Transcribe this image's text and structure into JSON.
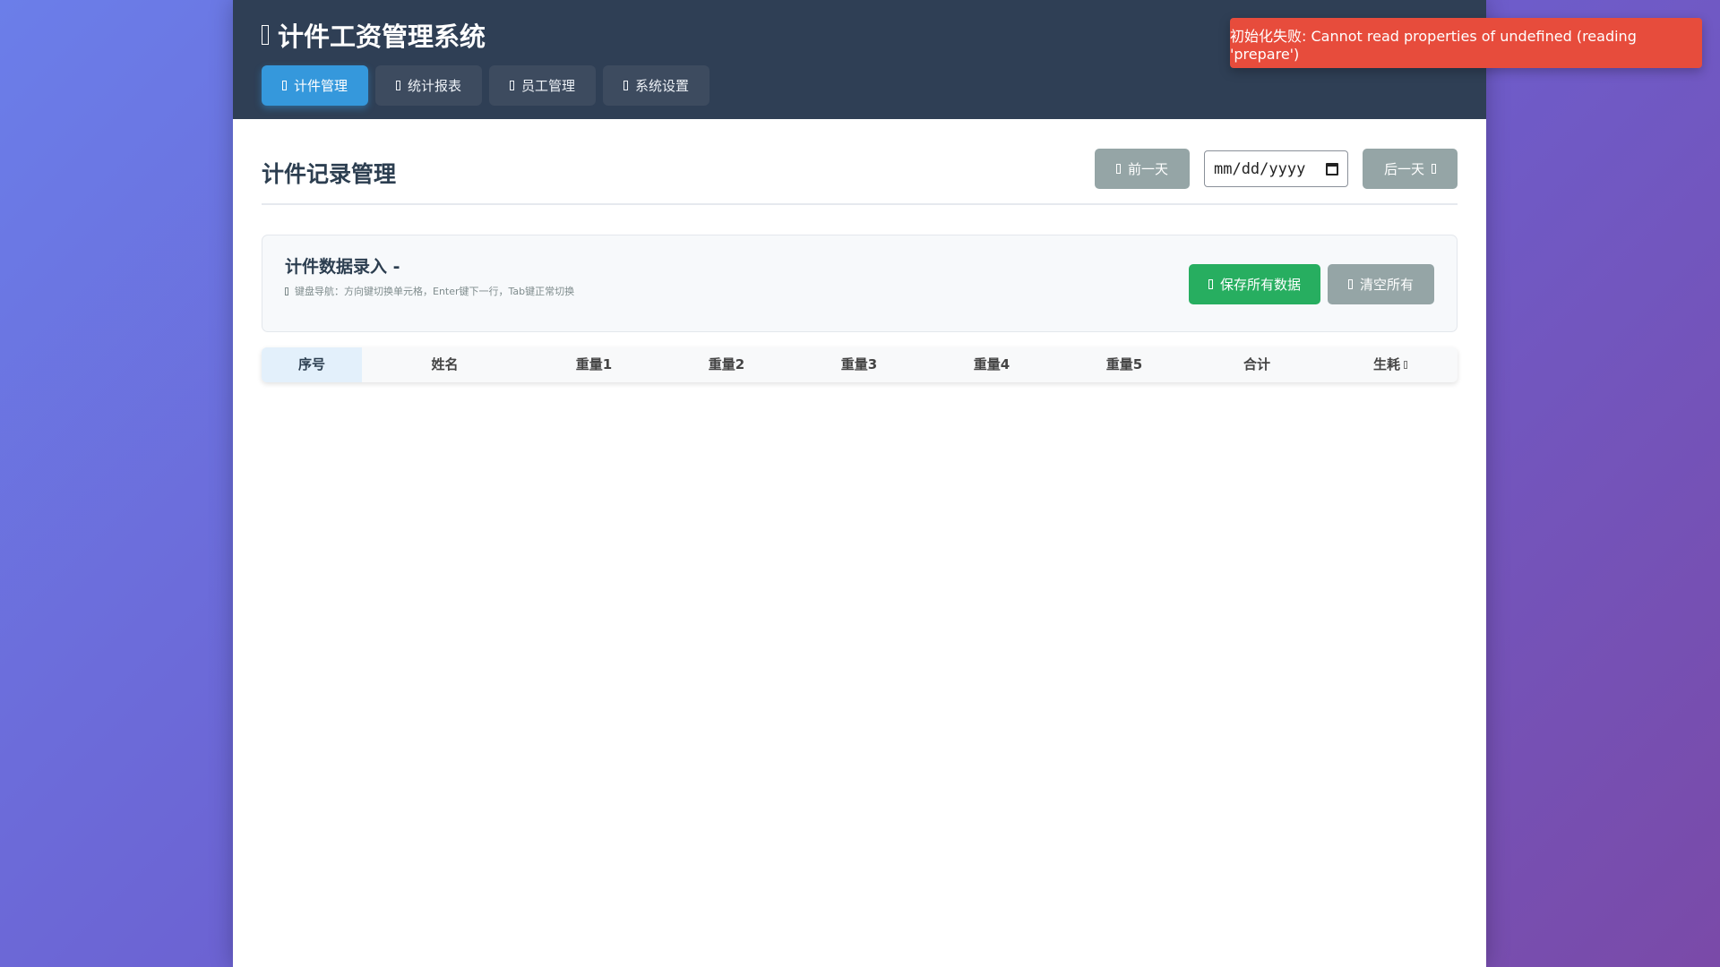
{
  "header": {
    "title": "计件工资管理系统",
    "title_icon": "app-logo-icon",
    "tabs": [
      {
        "label": "计件管理",
        "icon": "edit-icon",
        "active": true
      },
      {
        "label": "统计报表",
        "icon": "chart-icon",
        "active": false
      },
      {
        "label": "员工管理",
        "icon": "users-icon",
        "active": false
      },
      {
        "label": "系统设置",
        "icon": "settings-icon",
        "active": false
      }
    ]
  },
  "toast": {
    "message": "初始化失败: Cannot read properties of undefined (reading 'prepare')",
    "color": "#e74c3c"
  },
  "page": {
    "title": "计件记录管理",
    "prev_day": "前一天",
    "next_day": "后一天",
    "date_value": "",
    "date_placeholder": "mm/dd/yyyy"
  },
  "entry": {
    "title": "计件数据录入 -",
    "hint": "键盘导航：方向键切换单元格，Enter键下一行，Tab键正常切换",
    "save_all": "保存所有数据",
    "clear_all": "清空所有"
  },
  "table": {
    "columns": [
      "序号",
      "姓名",
      "重量1",
      "重量2",
      "重量3",
      "重量4",
      "重量5",
      "合计",
      "生耗"
    ]
  },
  "colors": {
    "header_bg": "#2f3f55",
    "accent": "#3598dc",
    "success": "#27ae60",
    "neutral": "#95a5a6",
    "error": "#e74c3c"
  }
}
